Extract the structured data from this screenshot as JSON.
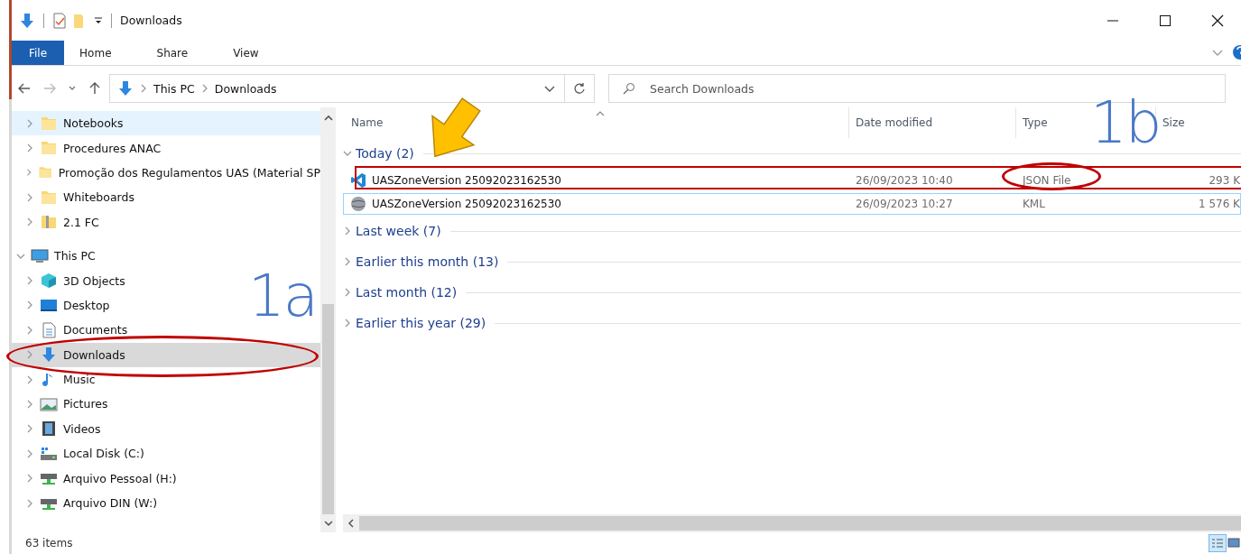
{
  "window": {
    "title": "Downloads"
  },
  "ribbon": {
    "tabs": [
      {
        "label": "File",
        "selected": true
      },
      {
        "label": "Home",
        "selected": false
      },
      {
        "label": "Share",
        "selected": false
      },
      {
        "label": "View",
        "selected": false
      }
    ]
  },
  "address": {
    "crumbs": [
      "This PC",
      "Downloads"
    ]
  },
  "search": {
    "placeholder": "Search Downloads"
  },
  "nav": [
    {
      "children": [
        {
          "label": "Notebooks",
          "expanded": false,
          "selected": false,
          "hovered": true
        },
        {
          "label": "Procedures ANAC",
          "expanded": false,
          "selected": false,
          "hovered": false
        },
        {
          "label": "Promoção dos Regulamentos UAS (Material SP",
          "expanded": false,
          "selected": false,
          "hovered": false
        },
        {
          "label": "Whiteboards",
          "expanded": false,
          "selected": false,
          "hovered": false
        },
        {
          "label": "2.1 FC",
          "expanded": false,
          "selected": false,
          "hovered": false
        }
      ]
    },
    {
      "label": "This PC",
      "expanded": true,
      "selected": false,
      "hovered": false,
      "children": [
        {
          "label": "3D Objects",
          "expanded": false,
          "selected": false,
          "hovered": false
        },
        {
          "label": "Desktop",
          "expanded": false,
          "selected": false,
          "hovered": false
        },
        {
          "label": "Documents",
          "expanded": false,
          "selected": false,
          "hovered": false
        },
        {
          "label": "Downloads",
          "expanded": false,
          "selected": true,
          "hovered": false
        },
        {
          "label": "Music",
          "expanded": false,
          "selected": false,
          "hovered": false
        },
        {
          "label": "Pictures",
          "expanded": false,
          "selected": false,
          "hovered": false
        },
        {
          "label": "Videos",
          "expanded": false,
          "selected": false,
          "hovered": false
        },
        {
          "label": "Local Disk (C:)",
          "expanded": false,
          "selected": false,
          "hovered": false
        },
        {
          "label": "Arquivo Pessoal (H:)",
          "expanded": false,
          "selected": false,
          "hovered": false
        },
        {
          "label": "Arquivo DIN (W:)",
          "expanded": false,
          "selected": false,
          "hovered": false
        }
      ]
    }
  ],
  "list": {
    "columns": [
      "Name",
      "Date modified",
      "Type",
      "Size"
    ],
    "groups": [
      {
        "label": "Today (2)",
        "expanded": true,
        "files": [
          {
            "name": "UASZoneVersion 25092023162530",
            "date": "26/09/2023 10:40",
            "type": "JSON File",
            "size": "293 K",
            "focused": false
          },
          {
            "name": "UASZoneVersion 25092023162530",
            "date": "26/09/2023 10:27",
            "type": "KML",
            "size": "1 576 K",
            "focused": true
          }
        ]
      },
      {
        "label": "Last week (7)",
        "expanded": false
      },
      {
        "label": "Earlier this month (13)",
        "expanded": false
      },
      {
        "label": "Last month (12)",
        "expanded": false
      },
      {
        "label": "Earlier this year (29)",
        "expanded": false
      }
    ]
  },
  "status_bar": {
    "count": "63 items"
  },
  "annotations": [
    {
      "kind": "arrow"
    },
    {
      "kind": "ellipse"
    },
    {
      "kind": "label",
      "text": "1a"
    },
    {
      "kind": "rect"
    },
    {
      "kind": "ellipse"
    },
    {
      "kind": "label",
      "text": "1b"
    }
  ]
}
